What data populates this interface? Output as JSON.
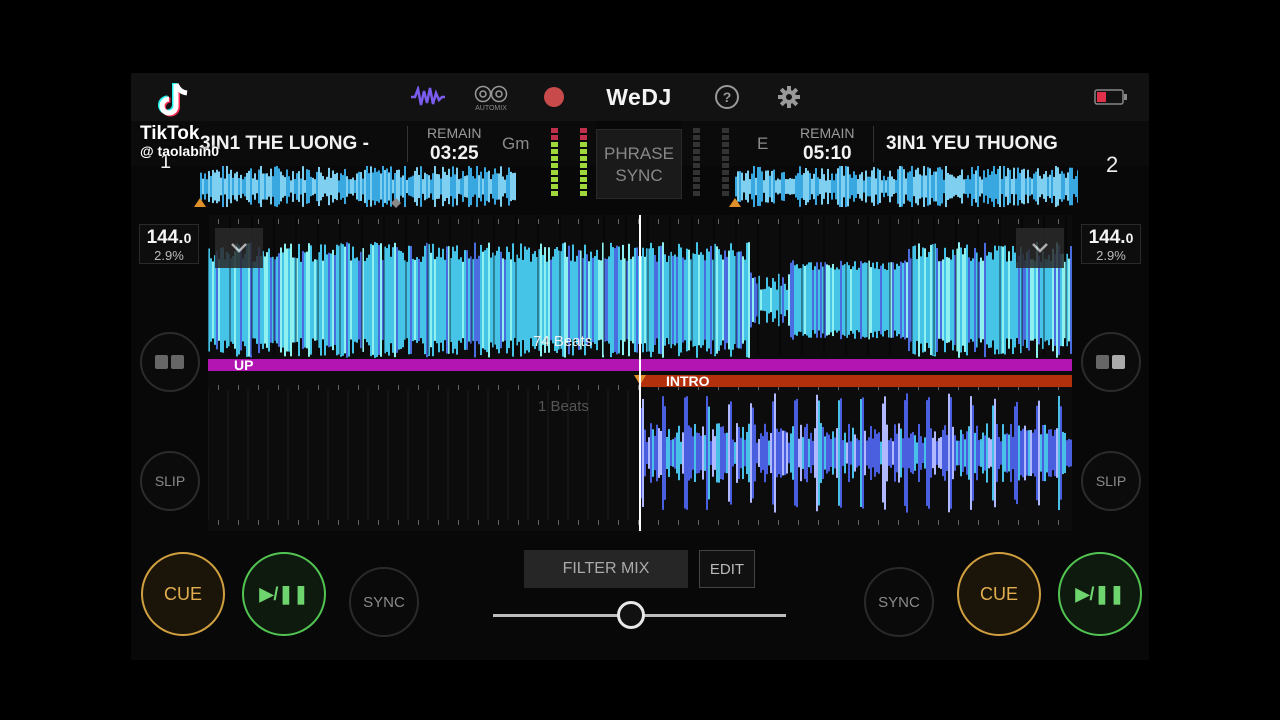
{
  "header": {
    "logo": "WeDJ",
    "automix_label": "AUTOMIX",
    "help_icon": "?",
    "battery_color": "#e0304a"
  },
  "deck1": {
    "number": "1",
    "title": "3IN1 THE LUONG -",
    "remain_label": "REMAIN",
    "remain": "03:25",
    "key": "Gm",
    "bpm_main": "144.",
    "bpm_dec": "0",
    "pitch": "2.9%",
    "beats_label": "74 Beats",
    "cue_label": "UP",
    "cue_label_color": "#b315b3",
    "buttons": {
      "cue": "CUE",
      "play": "▶/❚❚",
      "sync": "SYNC",
      "slip": "SLIP"
    }
  },
  "deck2": {
    "number": "2",
    "title": "3IN1 YEU THUONG",
    "remain_label": "REMAIN",
    "remain": "05:10",
    "key": "E",
    "bpm_main": "144.",
    "bpm_dec": "0",
    "pitch": "2.9%",
    "beats_label": "1 Beats",
    "cue_label": "INTRO",
    "cue_label_color": "#b3300c",
    "buttons": {
      "cue": "CUE",
      "play": "▶/❚❚",
      "sync": "SYNC",
      "slip": "SLIP"
    }
  },
  "center": {
    "phrase_sync": [
      "PHRASE",
      "SYNC"
    ],
    "filter_mix": "FILTER MIX",
    "edit": "EDIT",
    "crossfader_position": 0.47
  },
  "watermark": {
    "brand": "TikTok",
    "user": "@ taolabin0"
  }
}
